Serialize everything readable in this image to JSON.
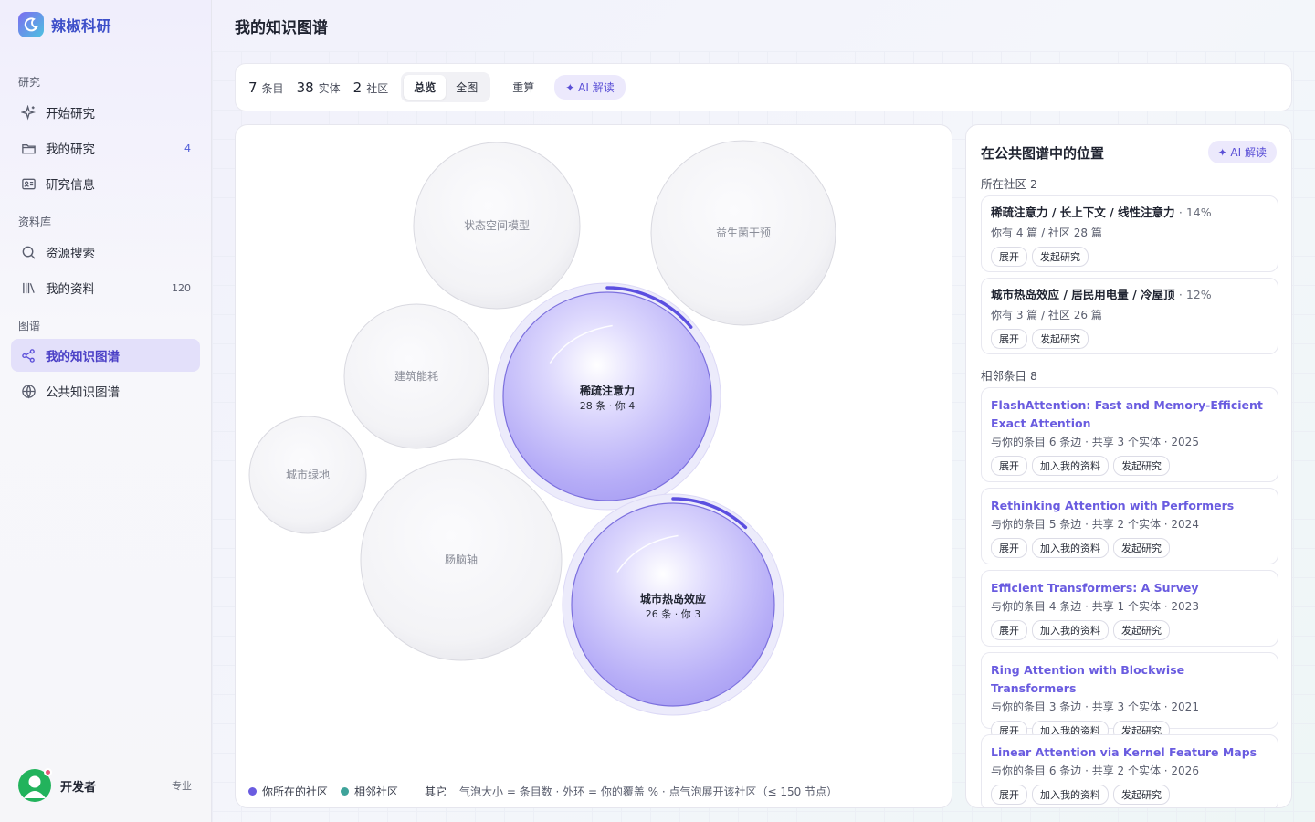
{
  "app": {
    "name": "辣椒科研"
  },
  "sidebar": {
    "sections": [
      {
        "label": "研究"
      },
      {
        "label": "资料库"
      },
      {
        "label": "图谱"
      }
    ],
    "items": [
      {
        "label": "开始研究",
        "icon": "sparkle-icon",
        "count": ""
      },
      {
        "label": "我的研究",
        "icon": "folder-icon",
        "count": "4"
      },
      {
        "label": "研究信息",
        "icon": "id-card-icon",
        "count": ""
      },
      {
        "label": "资源搜索",
        "icon": "search-icon",
        "count": ""
      },
      {
        "label": "我的资料",
        "icon": "library-icon",
        "count": "120"
      },
      {
        "label": "我的知识图谱",
        "icon": "graph-icon",
        "count": "",
        "active": true
      },
      {
        "label": "公共知识图谱",
        "icon": "globe-icon",
        "count": ""
      }
    ],
    "user": {
      "name": "开发者",
      "plan": "专业"
    }
  },
  "page": {
    "title": "我的知识图谱"
  },
  "toolbar": {
    "stats": [
      {
        "num": "7",
        "unit": "条目"
      },
      {
        "num": "38",
        "unit": "实体"
      },
      {
        "num": "2",
        "unit": "社区"
      }
    ],
    "view_modes": [
      "总览",
      "全图"
    ],
    "active_view": "总览",
    "recompute_label": "重算",
    "ai_label": "✦ AI 解读"
  },
  "graph": {
    "bubbles": [
      {
        "label": "状态空间模型",
        "type": "other"
      },
      {
        "label": "益生菌干预",
        "type": "other"
      },
      {
        "label": "建筑能耗",
        "type": "other"
      },
      {
        "label": "稀疏注意力",
        "sub": "28 条 · 你 4",
        "type": "mine",
        "coverage": 0.14
      },
      {
        "label": "城市绿地",
        "type": "other"
      },
      {
        "label": "肠脑轴",
        "type": "other"
      },
      {
        "label": "城市热岛效应",
        "sub": "26 条 · 你 3",
        "type": "mine",
        "coverage": 0.12
      }
    ],
    "legend": {
      "mine": "你所在的社区",
      "adjacent": "相邻社区",
      "other": "其它",
      "hint": "气泡大小 = 条目数 · 外环 = 你的覆盖 % · 点气泡展开该社区（≤ 150 节点）",
      "colors": {
        "mine": "#6a5ce0",
        "adjacent": "#3fa39a",
        "other": "#ffffff"
      }
    }
  },
  "right_panel": {
    "title": "在公共图谱中的位置",
    "ai_label": "✦ AI 解读",
    "communities_label": "所在社区 2",
    "communities": [
      {
        "title": "稀疏注意力 / 长上下文 / 线性注意力",
        "pct": "· 14%",
        "sub": "你有 4 篇 / 社区 28 篇",
        "actions": [
          "展开",
          "发起研究"
        ]
      },
      {
        "title": "城市热岛效应 / 居民用电量 / 冷屋顶",
        "pct": "· 12%",
        "sub": "你有 3 篇 / 社区 26 篇",
        "actions": [
          "展开",
          "发起研究"
        ]
      }
    ],
    "neighbors_label": "相邻条目 8",
    "neighbors": [
      {
        "title": "FlashAttention: Fast and Memory-Efficient Exact Attention",
        "sub": "与你的条目 6 条边 · 共享 3 个实体 · 2025",
        "actions": [
          "展开",
          "加入我的资料",
          "发起研究"
        ]
      },
      {
        "title": "Rethinking Attention with Performers",
        "sub": "与你的条目 5 条边 · 共享 2 个实体 · 2024",
        "actions": [
          "展开",
          "加入我的资料",
          "发起研究"
        ]
      },
      {
        "title": "Efficient Transformers: A Survey",
        "sub": "与你的条目 4 条边 · 共享 1 个实体 · 2023",
        "actions": [
          "展开",
          "加入我的资料",
          "发起研究"
        ]
      },
      {
        "title": "Ring Attention with Blockwise Transformers",
        "sub": "与你的条目 3 条边 · 共享 3 个实体 · 2021",
        "actions": [
          "展开",
          "加入我的资料",
          "发起研究"
        ]
      },
      {
        "title": "Linear Attention via Kernel Feature Maps",
        "sub": "与你的条目 6 条边 · 共享 2 个实体 · 2026",
        "actions": [
          "展开",
          "加入我的资料",
          "发起研究"
        ]
      }
    ]
  }
}
